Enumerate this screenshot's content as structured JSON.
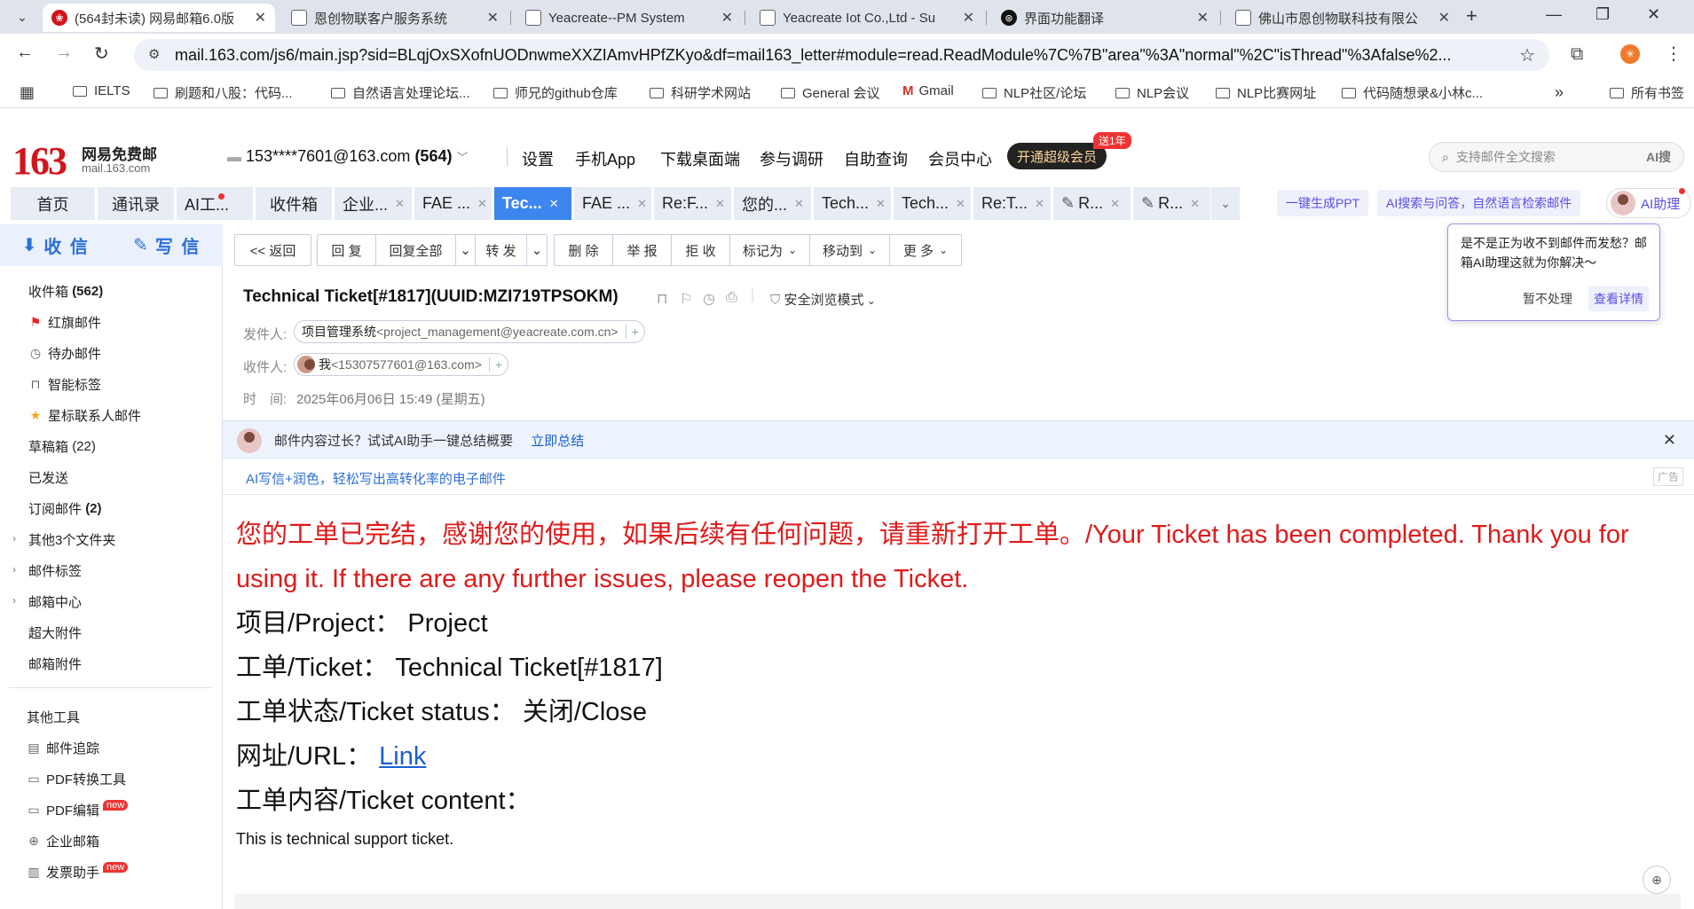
{
  "browser": {
    "tabs": [
      {
        "title": "(564封未读) 网易邮箱6.0版",
        "active": true
      },
      {
        "title": "恩创物联客户服务系统"
      },
      {
        "title": "Yeacreate--PM System"
      },
      {
        "title": "Yeacreate Iot Co.,Ltd - Su"
      },
      {
        "title": "界面功能翻译"
      },
      {
        "title": "佛山市恩创物联科技有限公"
      }
    ],
    "url": "mail.163.com/js6/main.jsp?sid=BLqjOxSXofnUODnwmeXXZIAmvHPfZKyo&df=mail163_letter#module=read.ReadModule%7C%7B\"area\"%3A\"normal\"%2C\"isThread\"%3Afalse%2...",
    "bookmarks": [
      "IELTS",
      "刷题和八股：代码...",
      "自然语言处理论坛...",
      "师兄的github仓库",
      "科研学术网站",
      "General 会议",
      "Gmail",
      "NLP社区/论坛",
      "NLP会议",
      "NLP比赛网址",
      "代码随想录&小林c..."
    ],
    "all_bookmarks": "所有书签"
  },
  "mail": {
    "logo_num": "163",
    "logo_text": "网易免费邮",
    "logo_sub": "mail.163.com",
    "account": "153****7601@163.com",
    "account_count": "(564)",
    "top_nav": [
      "设置",
      "手机App",
      "下载桌面端",
      "参与调研",
      "自助查询",
      "会员中心"
    ],
    "vip_button": "开通超级会员",
    "vip_badge": "送1年",
    "search_placeholder": "支持邮件全文搜索",
    "search_ai": "AI搜",
    "tabs": [
      "首页",
      "通讯录",
      "AI工...",
      "收件箱",
      "企业...",
      "FAE ...",
      "Tec...",
      "FAE ...",
      "Re:F...",
      "您的...",
      "Tech...",
      "Tech...",
      "Re:T...",
      "R...",
      "R..."
    ],
    "ai_ppt": "一键生成PPT",
    "ai_search": "AI搜索与问答，自然语言检索邮件",
    "ai_assistant": "AI助理"
  },
  "sidebar": {
    "receive": "收 信",
    "compose": "写 信",
    "inbox": "收件箱",
    "inbox_count": "(562)",
    "flagged": "红旗邮件",
    "todo": "待办邮件",
    "smart_tag": "智能标签",
    "star_contacts": "星标联系人邮件",
    "drafts": "草稿箱",
    "drafts_count": "(22)",
    "sent": "已发送",
    "subscriptions": "订阅邮件",
    "subscriptions_count": "(2)",
    "other_folders": "其他3个文件夹",
    "mail_tags": "邮件标签",
    "mail_center": "邮箱中心",
    "large_attach": "超大附件",
    "mail_attach": "邮箱附件",
    "tools_title": "其他工具",
    "tracking": "邮件追踪",
    "pdf_convert": "PDF转换工具",
    "pdf_edit": "PDF编辑",
    "enterprise": "企业邮箱",
    "invoice": "发票助手",
    "new_label": "new"
  },
  "toolbar": {
    "back": "<< 返回",
    "reply": "回 复",
    "reply_all": "回复全部",
    "forward": "转 发",
    "delete": "删 除",
    "report": "举 报",
    "recall": "拒 收",
    "mark": "标记为",
    "move": "移动到",
    "more": "更 多"
  },
  "message": {
    "subject": "Technical Ticket[#1817](UUID:MZI719TPSOKM)",
    "safe_mode": "安全浏览模式",
    "from_label": "发件人:",
    "from_name": "项目管理系统",
    "from_addr": "<project_management@yeacreate.com.cn>",
    "to_label": "收件人:",
    "to_name": "我",
    "to_addr": "<15307577601@163.com>",
    "time_label": "时　间:",
    "time": "2025年06月06日 15:49 (星期五)",
    "ai_banner": "邮件内容过长？试试AI助手一键总结概要",
    "ai_banner_link": "立即总结",
    "ad_text": "AI写信+润色，轻松写出高转化率的电子邮件",
    "ad_tag": "广告",
    "body": {
      "completed_text": "您的工单已完结，感谢您的使用，如果后续有任何问题，请重新打开工单。/Your Ticket has been completed. Thank you for using it. If there are any further issues, please reopen the Ticket.",
      "project_label": "项目/Project：",
      "project_value": "Project",
      "ticket_label": "工单/Ticket：",
      "ticket_value": "Technical Ticket[#1817]",
      "status_label": "工单状态/Ticket status：",
      "status_value": "关闭/Close",
      "url_label": "网址/URL：",
      "url_value": "Link",
      "content_label": "工单内容/Ticket content：",
      "content_value": "This is technical support ticket."
    }
  },
  "popup": {
    "text": "是不是正为收不到邮件而发愁？邮箱AI助理这就为你解决～",
    "ignore": "暂不处理",
    "details": "查看详情"
  },
  "colors": {
    "brand_red": "#d1151d",
    "accent_blue": "#3d86f0",
    "body_red": "#e01a1a",
    "ai_purple": "#5a4ee6"
  }
}
